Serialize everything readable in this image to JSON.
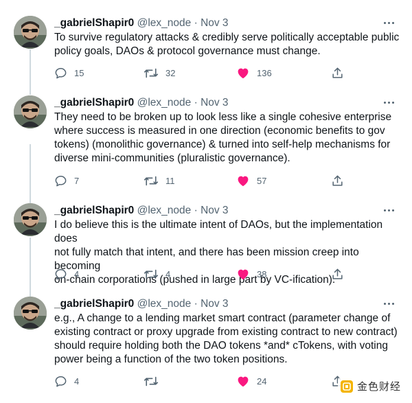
{
  "tweets": [
    {
      "name": "_gabrielShapir0",
      "handle": "@lex_node",
      "separator": "·",
      "date": "Nov 3",
      "lines": [
        "To survive regulatory attacks & credibly serve politically acceptable public",
        "policy goals, DAOs & protocol governance must change."
      ],
      "replies": "15",
      "retweets": "32",
      "likes": "136"
    },
    {
      "name": "_gabrielShapir0",
      "handle": "@lex_node",
      "separator": "·",
      "date": "Nov 3",
      "lines": [
        "They need to be broken up to look less like a single cohesive enterprise",
        "where success is measured in one direction (economic benefits to gov",
        "tokens) (monolithic governance) & turned into self-help mechanisms for",
        "diverse mini-communities (pluralistic governance)."
      ],
      "replies": "7",
      "retweets": "11",
      "likes": "57"
    },
    {
      "name": "_gabrielShapir0",
      "handle": "@lex_node",
      "separator": "·",
      "date": "Nov 3",
      "lines": [
        "I do believe this is the ultimate intent of DAOs, but the implementation does",
        "not fully match that intent, and there has been mission creep into becoming",
        "on-chain corporations (pushed in large part by VC-ification)."
      ],
      "replies": "4",
      "retweets": "4",
      "likes": "38"
    },
    {
      "name": "_gabrielShapir0",
      "handle": "@lex_node",
      "separator": "·",
      "date": "Nov 3",
      "lines": [
        "e.g., A change to a lending market smart contract (parameter change of",
        "existing contract or proxy upgrade from existing contract to new contract)",
        "should require holding both the DAO tokens *and* cTokens, with voting",
        "power being a function of the two token positions."
      ],
      "replies": "4",
      "retweets": "",
      "likes": "24"
    }
  ],
  "watermark": {
    "text": "金色财经"
  },
  "colors": {
    "like": "#f91880",
    "muted": "#536471",
    "text": "#0f1419",
    "thread": "#cfd9de"
  },
  "icons": [
    "reply-icon",
    "retweet-icon",
    "like-icon",
    "share-icon",
    "more-icon"
  ]
}
